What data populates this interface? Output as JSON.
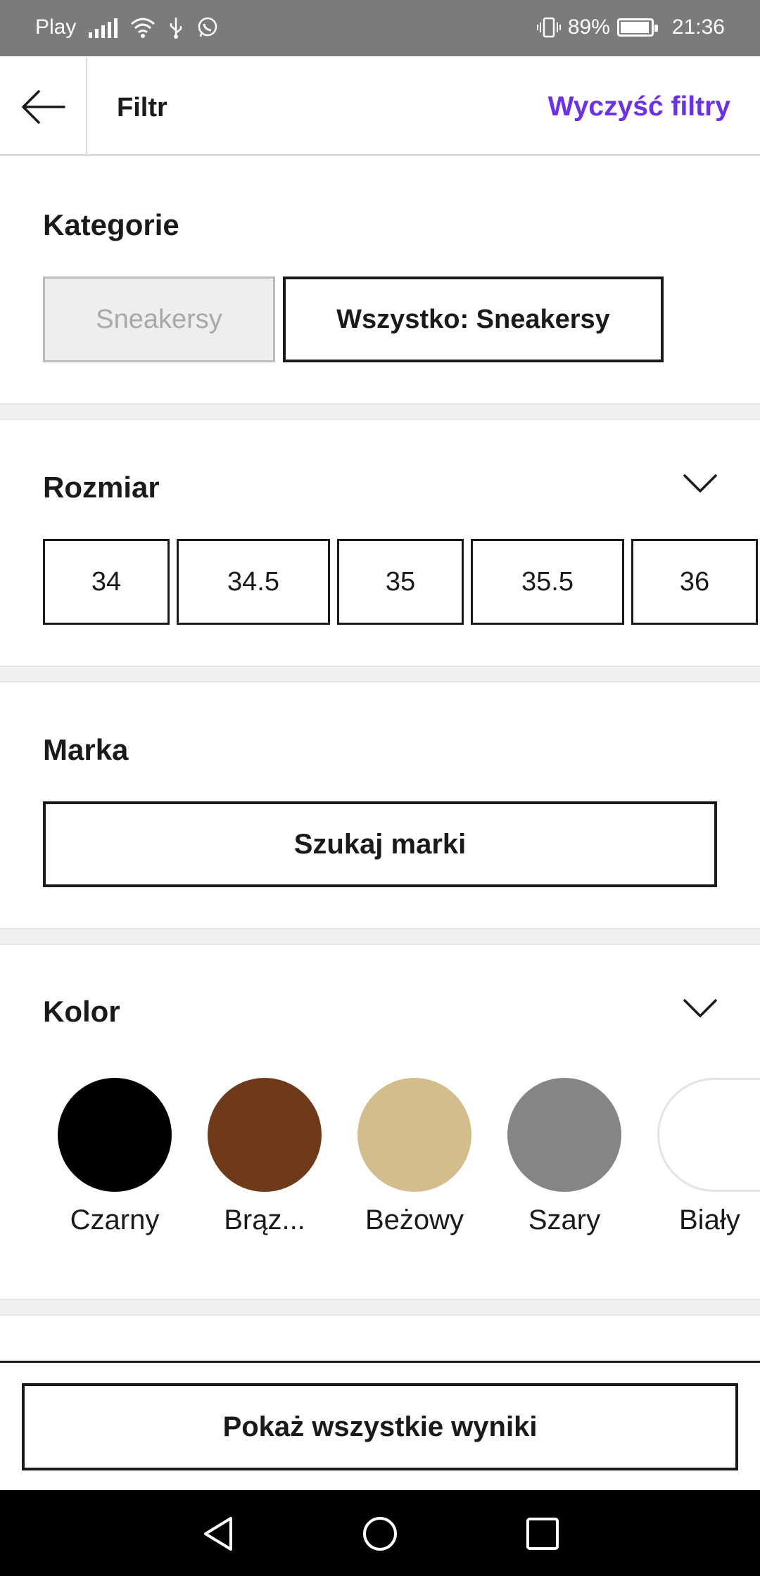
{
  "status_bar": {
    "carrier": "Play",
    "battery": "89%",
    "time": "21:36"
  },
  "header": {
    "title": "Filtr",
    "clear_label": "Wyczyść filtry",
    "back_icon": "arrow-left-icon"
  },
  "colors": {
    "accent": "#6b2ff0",
    "text": "#1a1a1a",
    "divider": "#f0f0f0"
  },
  "category": {
    "title": "Kategorie",
    "chips": [
      {
        "label": "Sneakersy",
        "state": "disabled"
      },
      {
        "label": "Wszystko: Sneakersy",
        "state": "selected"
      }
    ]
  },
  "size": {
    "title": "Rozmiar",
    "options": [
      "34",
      "34.5",
      "35",
      "35.5",
      "36"
    ]
  },
  "brand": {
    "title": "Marka",
    "search_label": "Szukaj marki"
  },
  "color_filter": {
    "title": "Kolor",
    "options": [
      {
        "label": "Czarny",
        "hex": "#000000"
      },
      {
        "label": "Brąz...",
        "hex": "#6f3a1a"
      },
      {
        "label": "Beżowy",
        "hex": "#d4bd8c"
      },
      {
        "label": "Szary",
        "hex": "#858585"
      },
      {
        "label": "Biały",
        "hex": "#ffffff"
      }
    ]
  },
  "footer": {
    "show_results_label": "Pokaż wszystkie wyniki"
  }
}
